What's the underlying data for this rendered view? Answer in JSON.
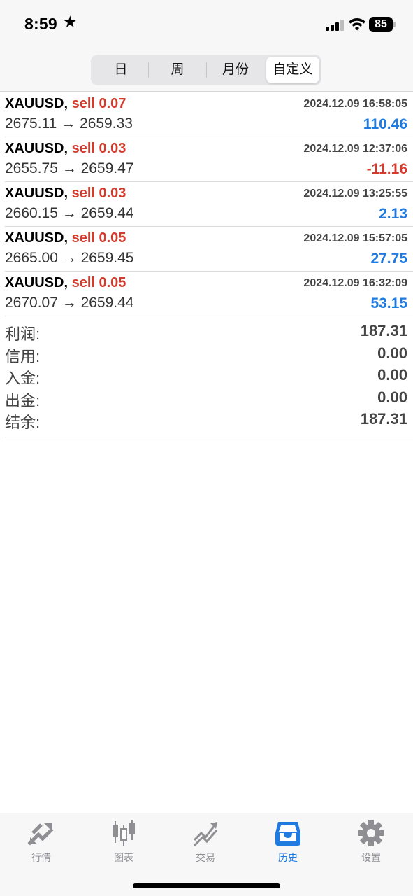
{
  "status_bar": {
    "time": "8:59",
    "star": "★",
    "battery": "85"
  },
  "segmented": [
    {
      "label": "日",
      "active": false
    },
    {
      "label": "周",
      "active": false
    },
    {
      "label": "月份",
      "active": false
    },
    {
      "label": "自定义",
      "active": true
    }
  ],
  "trades": [
    {
      "symbol": "XAUUSD,",
      "side": "sell 0.07",
      "time": "2024.12.09 16:58:05",
      "prices": "2675.11 → 2659.33",
      "profit": "110.46",
      "sign": "pos"
    },
    {
      "symbol": "XAUUSD,",
      "side": "sell 0.03",
      "time": "2024.12.09 12:37:06",
      "prices": "2655.75 → 2659.47",
      "profit": "-11.16",
      "sign": "neg"
    },
    {
      "symbol": "XAUUSD,",
      "side": "sell 0.03",
      "time": "2024.12.09 13:25:55",
      "prices": "2660.15 → 2659.44",
      "profit": "2.13",
      "sign": "pos"
    },
    {
      "symbol": "XAUUSD,",
      "side": "sell 0.05",
      "time": "2024.12.09 15:57:05",
      "prices": "2665.00 → 2659.45",
      "profit": "27.75",
      "sign": "pos"
    },
    {
      "symbol": "XAUUSD,",
      "side": "sell 0.05",
      "time": "2024.12.09 16:32:09",
      "prices": "2670.07 → 2659.44",
      "profit": "53.15",
      "sign": "pos"
    }
  ],
  "summary": [
    {
      "label": "利润:",
      "value": "187.31"
    },
    {
      "label": "信用:",
      "value": "0.00"
    },
    {
      "label": "入金:",
      "value": "0.00"
    },
    {
      "label": "出金:",
      "value": "0.00"
    },
    {
      "label": "结余:",
      "value": "187.31"
    }
  ],
  "tabs": [
    {
      "label": "行情",
      "icon": "quotes-icon",
      "active": false
    },
    {
      "label": "图表",
      "icon": "chart-icon",
      "active": false
    },
    {
      "label": "交易",
      "icon": "trade-icon",
      "active": false
    },
    {
      "label": "历史",
      "icon": "history-icon",
      "active": true
    },
    {
      "label": "设置",
      "icon": "settings-icon",
      "active": false
    }
  ],
  "colors": {
    "accent": "#1f7be0",
    "loss": "#d23a2c",
    "inactive": "#8e8e93"
  }
}
